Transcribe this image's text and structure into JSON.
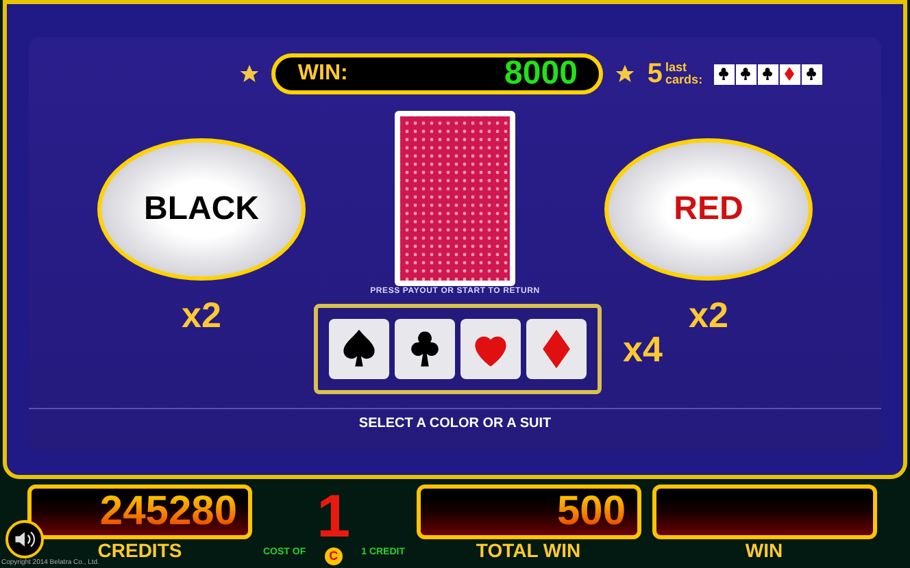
{
  "win_bar": {
    "label": "WIN:",
    "value": "8000"
  },
  "last_cards": {
    "count": "5",
    "label_top": "last",
    "label_bottom": "cards:",
    "cards": [
      {
        "kind": "club"
      },
      {
        "kind": "club"
      },
      {
        "kind": "club"
      },
      {
        "kind": "diamond"
      },
      {
        "kind": "club"
      }
    ]
  },
  "color_buttons": [
    {
      "label": "BLACK",
      "kind": "black",
      "multiplier": "x2"
    },
    {
      "label": "RED",
      "kind": "red",
      "multiplier": "x2"
    }
  ],
  "hint": "PRESS PAYOUT OR START TO RETURN",
  "suits": [
    {
      "kind": "spade"
    },
    {
      "kind": "club"
    },
    {
      "kind": "heart"
    },
    {
      "kind": "diamond"
    }
  ],
  "suit_multiplier": "x4",
  "instruction": "SELECT A COLOR OR A SUIT",
  "bottom": {
    "credits": {
      "value": "245280",
      "label": "CREDITS"
    },
    "cost_of": "COST OF",
    "bet": "1",
    "currency": "C",
    "per": "1 CREDIT",
    "total_win": {
      "value": "500",
      "label": "TOTAL WIN"
    },
    "win": {
      "label": "WIN"
    }
  },
  "copyright": "Copyright 2014  Belatra Co., Ltd."
}
